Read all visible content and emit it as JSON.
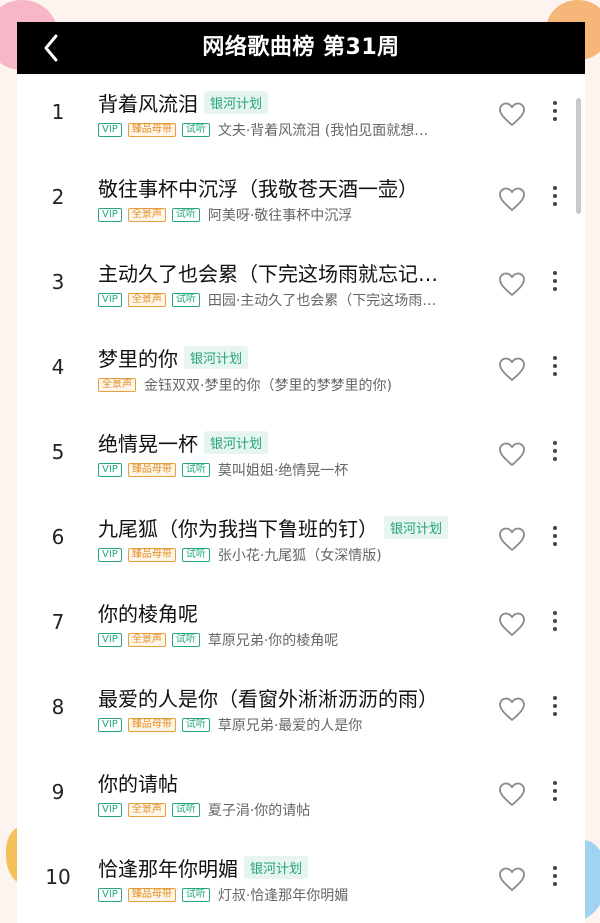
{
  "header": {
    "title": "网络歌曲榜 第31周"
  },
  "colors": {
    "accent_green": "#26a87c",
    "gold": "#e08f28",
    "header_bg": "#000000"
  },
  "icons": {
    "back": "chevron-left-icon",
    "like": "heart-outline-icon",
    "more": "more-vertical-icon"
  },
  "songs": [
    {
      "rank": "1",
      "title": "背着风流泪",
      "plan": "银河计划",
      "tags": [
        "VIP",
        "臻品母带",
        "试听"
      ],
      "artist": "文夫·背着风流泪 (我怕见面就想…"
    },
    {
      "rank": "2",
      "title": "敬往事杯中沉浮（我敬苍天酒一壶）",
      "plan": "",
      "tags": [
        "VIP",
        "全景声",
        "试听"
      ],
      "artist": "阿美呀·敬往事杯中沉浮"
    },
    {
      "rank": "3",
      "title": "主动久了也会累（下完这场雨就忘记…",
      "plan": "",
      "tags": [
        "VIP",
        "全景声",
        "试听"
      ],
      "artist": "田园·主动久了也会累（下完这场雨…"
    },
    {
      "rank": "4",
      "title": "梦里的你",
      "plan": "银河计划",
      "tags": [
        "全景声"
      ],
      "artist": "金钰双双·梦里的你（梦里的梦梦里的你)"
    },
    {
      "rank": "5",
      "title": "绝情晃一杯",
      "plan": "银河计划",
      "tags": [
        "VIP",
        "臻品母带",
        "试听"
      ],
      "artist": "莫叫姐姐·绝情晃一杯"
    },
    {
      "rank": "6",
      "title": "九尾狐（你为我挡下鲁班的钉）",
      "plan": "银河计划",
      "tags": [
        "VIP",
        "臻品母带",
        "试听"
      ],
      "artist": "张小花·九尾狐（女深情版)"
    },
    {
      "rank": "7",
      "title": "你的棱角呢",
      "plan": "",
      "tags": [
        "VIP",
        "全景声",
        "试听"
      ],
      "artist": "草原兄弟·你的棱角呢"
    },
    {
      "rank": "8",
      "title": "最爱的人是你（看窗外淅淅沥沥的雨）",
      "plan": "",
      "tags": [
        "VIP",
        "臻品母带",
        "试听"
      ],
      "artist": "草原兄弟·最爱的人是你"
    },
    {
      "rank": "9",
      "title": "你的请帖",
      "plan": "",
      "tags": [
        "VIP",
        "全景声",
        "试听"
      ],
      "artist": "夏子涓·你的请帖"
    },
    {
      "rank": "10",
      "title": "恰逢那年你明媚",
      "plan": "银河计划",
      "tags": [
        "VIP",
        "臻品母带",
        "试听"
      ],
      "artist": "灯叔·恰逢那年你明媚"
    }
  ]
}
